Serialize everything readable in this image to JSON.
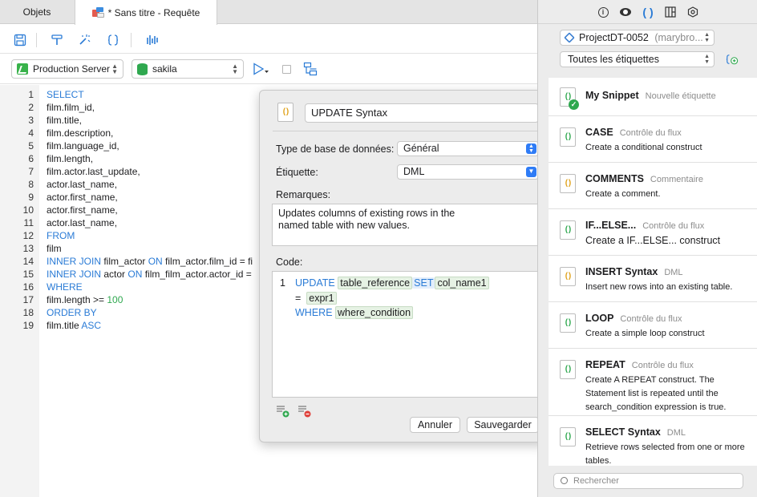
{
  "tabs": {
    "objects": "Objets",
    "query": "* Sans titre - Requête"
  },
  "toolbar": {
    "icons": [
      "save-icon",
      "format-icon",
      "magic-wand-icon",
      "braces-icon",
      "explain-icon"
    ]
  },
  "connection": {
    "server": "Production Server",
    "database": "sakila"
  },
  "editor": {
    "lines": [
      {
        "n": "1",
        "parts": [
          {
            "t": "SELECT",
            "c": "kw"
          }
        ]
      },
      {
        "n": "2",
        "parts": [
          {
            "t": "film.film_id,",
            "c": ""
          }
        ]
      },
      {
        "n": "3",
        "parts": [
          {
            "t": "film.title,",
            "c": ""
          }
        ]
      },
      {
        "n": "4",
        "parts": [
          {
            "t": "film.description,",
            "c": ""
          }
        ]
      },
      {
        "n": "5",
        "parts": [
          {
            "t": "film.language_id,",
            "c": ""
          }
        ]
      },
      {
        "n": "6",
        "parts": [
          {
            "t": "film.length,",
            "c": ""
          }
        ]
      },
      {
        "n": "7",
        "parts": [
          {
            "t": "film.actor.last_update,",
            "c": ""
          }
        ]
      },
      {
        "n": "8",
        "parts": [
          {
            "t": "actor.last_name,",
            "c": ""
          }
        ]
      },
      {
        "n": "9",
        "parts": [
          {
            "t": "actor.first_name,",
            "c": ""
          }
        ]
      },
      {
        "n": "10",
        "parts": [
          {
            "t": "actor.first_name,",
            "c": ""
          }
        ]
      },
      {
        "n": "11",
        "parts": [
          {
            "t": "actor.last_name,",
            "c": ""
          }
        ]
      },
      {
        "n": "12",
        "parts": [
          {
            "t": "FROM",
            "c": "kw"
          }
        ]
      },
      {
        "n": "13",
        "parts": [
          {
            "t": "film",
            "c": ""
          }
        ]
      },
      {
        "n": "14",
        "parts": [
          {
            "t": "INNER JOIN",
            "c": "kw"
          },
          {
            "t": " film_actor ",
            "c": ""
          },
          {
            "t": "ON",
            "c": "kw"
          },
          {
            "t": " film_actor.film_id = fi",
            "c": ""
          }
        ]
      },
      {
        "n": "15",
        "parts": [
          {
            "t": "INNER JOIN",
            "c": "kw"
          },
          {
            "t": " actor ",
            "c": ""
          },
          {
            "t": "ON",
            "c": "kw"
          },
          {
            "t": " film_film_actor.actor_id =",
            "c": ""
          }
        ]
      },
      {
        "n": "16",
        "parts": [
          {
            "t": "WHERE",
            "c": "kw"
          }
        ]
      },
      {
        "n": "17",
        "parts": [
          {
            "t": "film.length >= ",
            "c": ""
          },
          {
            "t": "100",
            "c": "num"
          }
        ]
      },
      {
        "n": "18",
        "parts": [
          {
            "t": "ORDER BY",
            "c": "kw"
          }
        ]
      },
      {
        "n": "19",
        "parts": [
          {
            "t": "film.title ",
            "c": ""
          },
          {
            "t": "ASC",
            "c": "kw"
          }
        ]
      }
    ]
  },
  "snippet_editor": {
    "name": "UPDATE Syntax",
    "db_type_label": "Type de base de données:",
    "db_type_value": "Général",
    "label_label": "Étiquette:",
    "label_value": "DML",
    "remarks_label": "Remarques:",
    "remarks_line1": "Updates columns of existing rows in the",
    "remarks_line2": "named table with new values.",
    "code_label": "Code:",
    "code_line_no": "1",
    "code": {
      "kw_update": "UPDATE",
      "ph_table": "table_reference",
      "kw_set": "SET",
      "ph_col": "col_name1",
      "eq": "=",
      "ph_expr": "expr1",
      "kw_where": "WHERE",
      "ph_where": "where_condition"
    },
    "cancel": "Annuler",
    "save": "Sauvegarder"
  },
  "right_panel": {
    "project": "ProjectDT-0052",
    "project_owner": "(marybro...",
    "filter": "Toutes les étiquettes",
    "snippets": [
      {
        "name": "My Snippet",
        "tag": "Nouvelle étiquette",
        "desc": [],
        "badge": "check"
      },
      {
        "name": "CASE",
        "tag": "Contrôle du flux",
        "desc": [
          "Create a conditional construct"
        ],
        "badge": ""
      },
      {
        "name": "COMMENTS",
        "tag": "Commentaire",
        "desc": [
          "Create a comment."
        ],
        "badge": ""
      },
      {
        "name": "IF...ELSE...",
        "tag": "Contrôle du flux",
        "desc": [
          "Create a IF...ELSE... construct"
        ],
        "badge": ""
      },
      {
        "name": "INSERT Syntax",
        "tag": "DML",
        "desc": [
          "Insert new rows into an existing table."
        ],
        "badge": ""
      },
      {
        "name": "LOOP",
        "tag": "Contrôle du flux",
        "desc": [
          "Create a simple loop construct"
        ],
        "badge": ""
      },
      {
        "name": "REPEAT",
        "tag": "Contrôle du flux",
        "desc": [
          "Create A REPEAT construct. The",
          "Statement list is repeated until the",
          "search_condition expression is true."
        ],
        "badge": ""
      },
      {
        "name": "SELECT Syntax",
        "tag": "DML",
        "desc": [
          "Retrieve rows selected from one or more",
          "tables."
        ],
        "badge": ""
      }
    ],
    "search_placeholder": "Rechercher"
  },
  "colors": {
    "accent": "#2a7bd6",
    "keyword": "#2a7bd6",
    "number": "#2fa84f",
    "placeholder_bg": "#e6f2e4"
  }
}
